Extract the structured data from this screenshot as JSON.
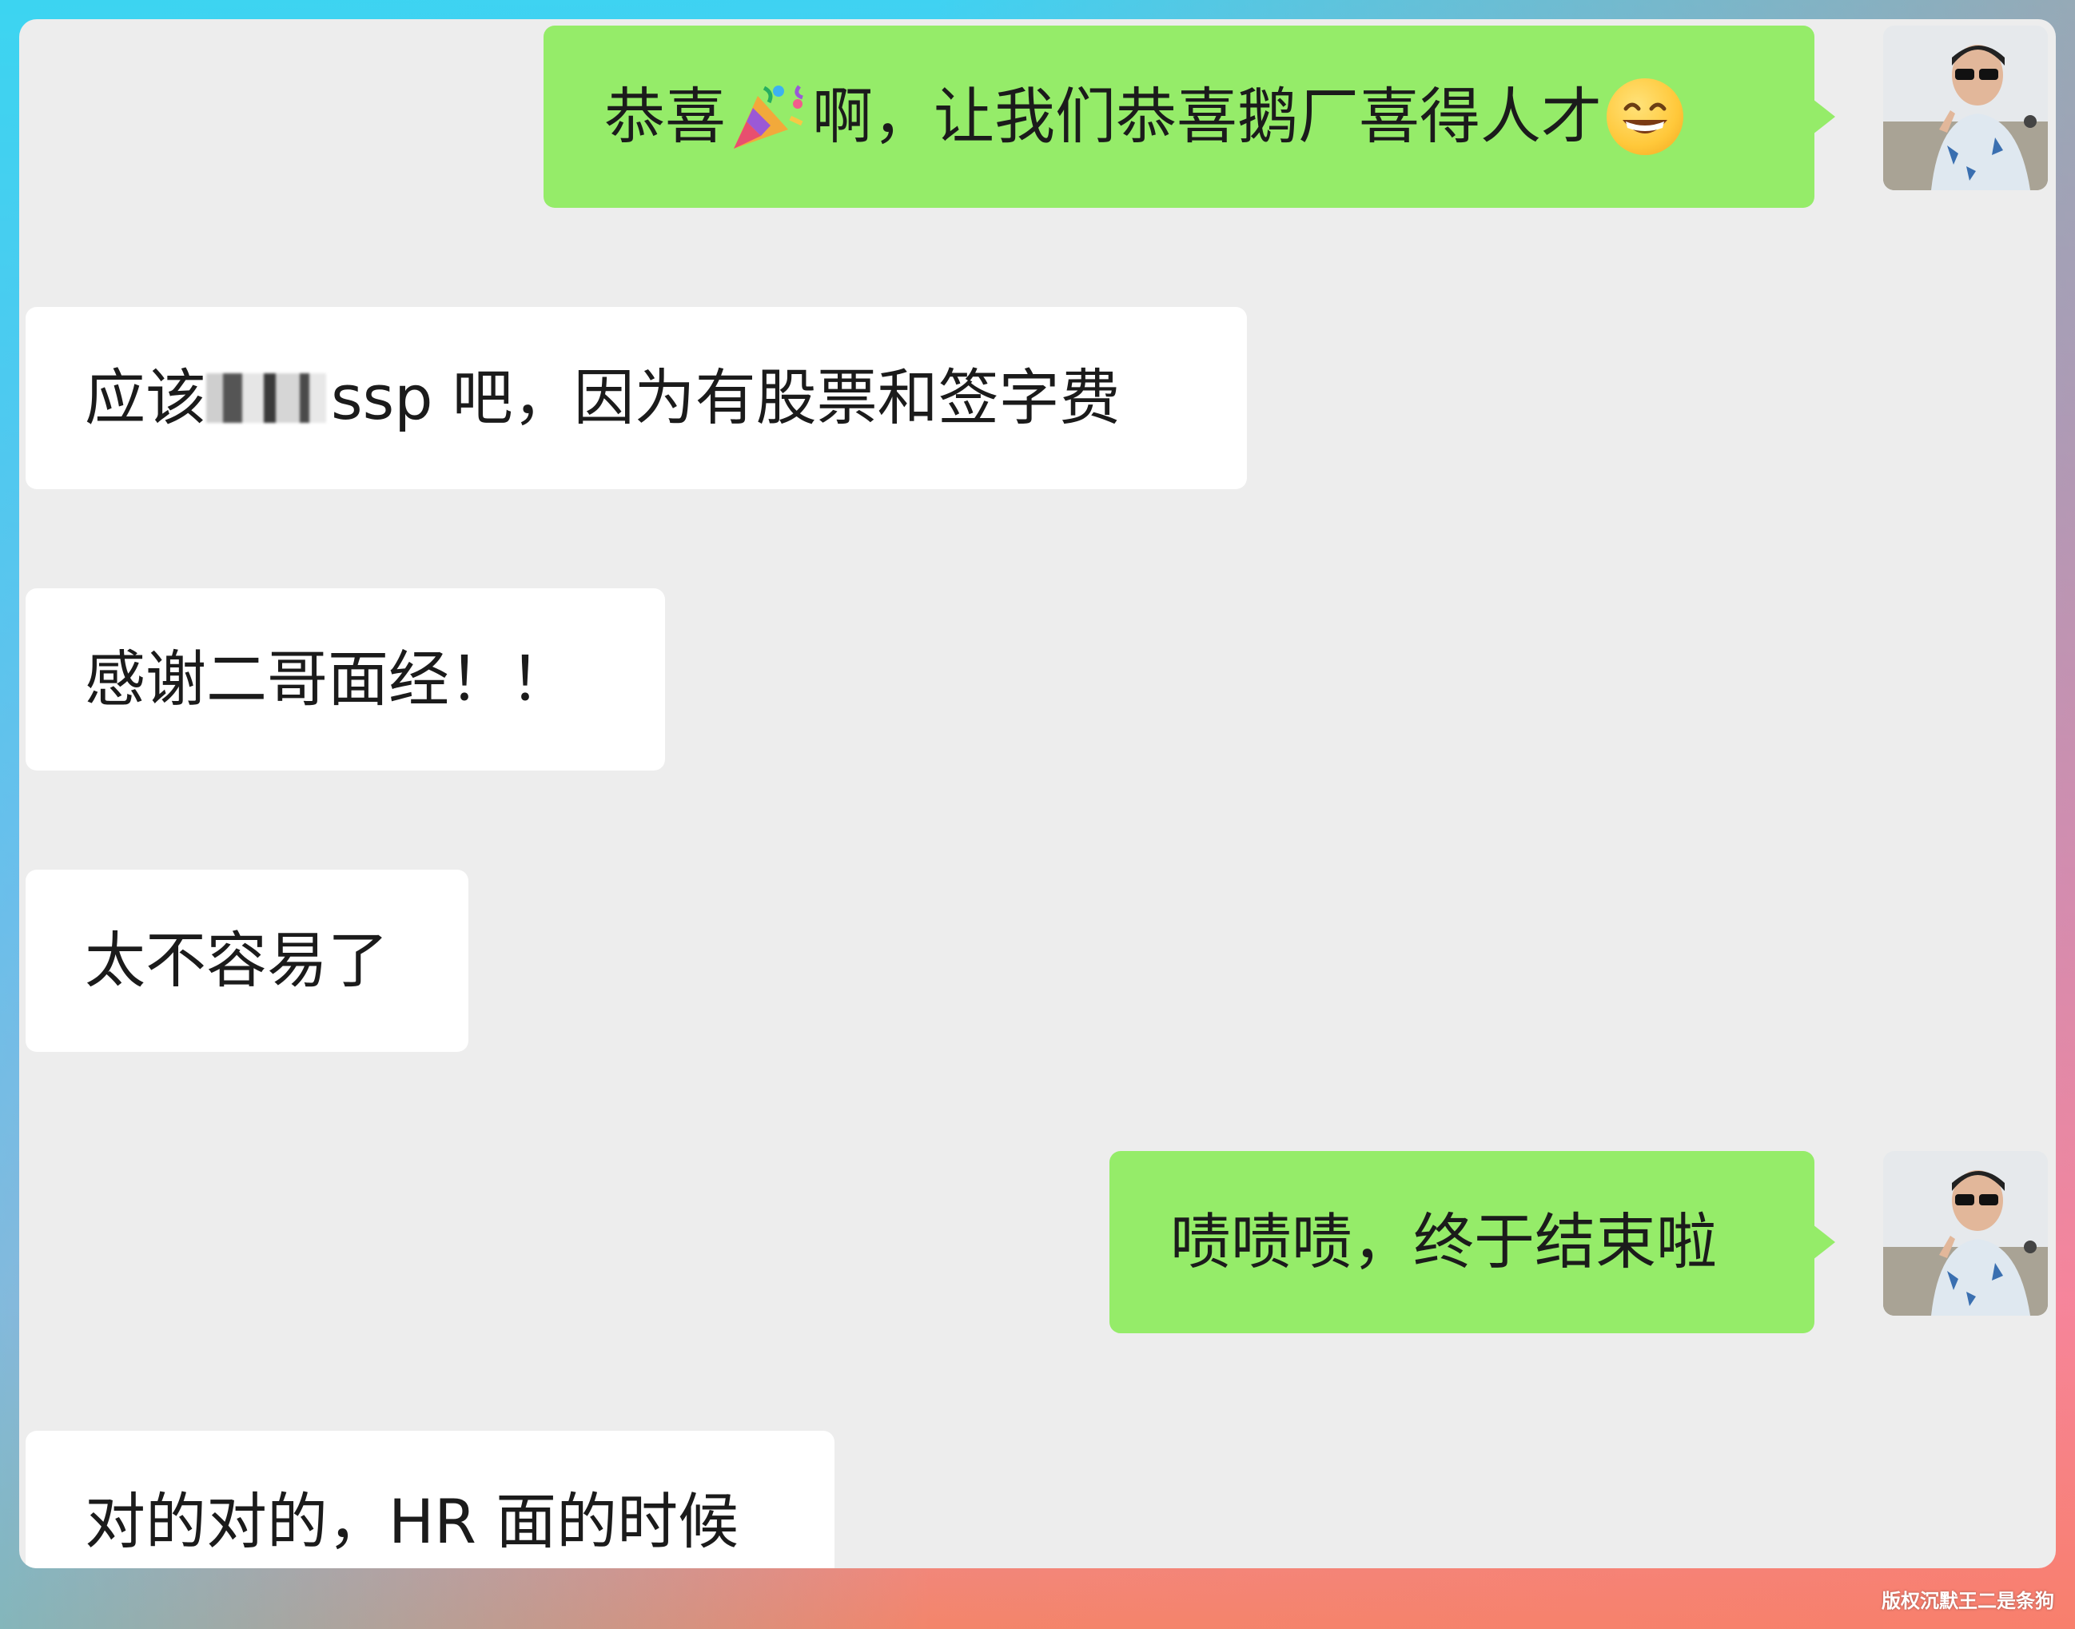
{
  "messages": [
    {
      "sender": "me",
      "text_before_emoji": "恭喜",
      "emoji_1": "party-popper",
      "text_after_emoji": "啊，让我们恭喜鹅厂喜得人才",
      "emoji_2": "grinning-face"
    },
    {
      "sender": "them",
      "text_before_blur": "应该",
      "text_after_blur": "ssp 吧，因为有股票和签字费"
    },
    {
      "sender": "them",
      "text": "感谢二哥面经！！"
    },
    {
      "sender": "them",
      "text": "太不容易了"
    },
    {
      "sender": "me",
      "text": "啧啧啧，终于结束啦"
    },
    {
      "sender": "them",
      "text": "对的对的，HR 面的时候"
    }
  ],
  "watermark": "版权沉默王二是条狗",
  "colors": {
    "my_bubble": "#95ec69",
    "their_bubble": "#ffffff",
    "chat_background": "#ededed"
  }
}
